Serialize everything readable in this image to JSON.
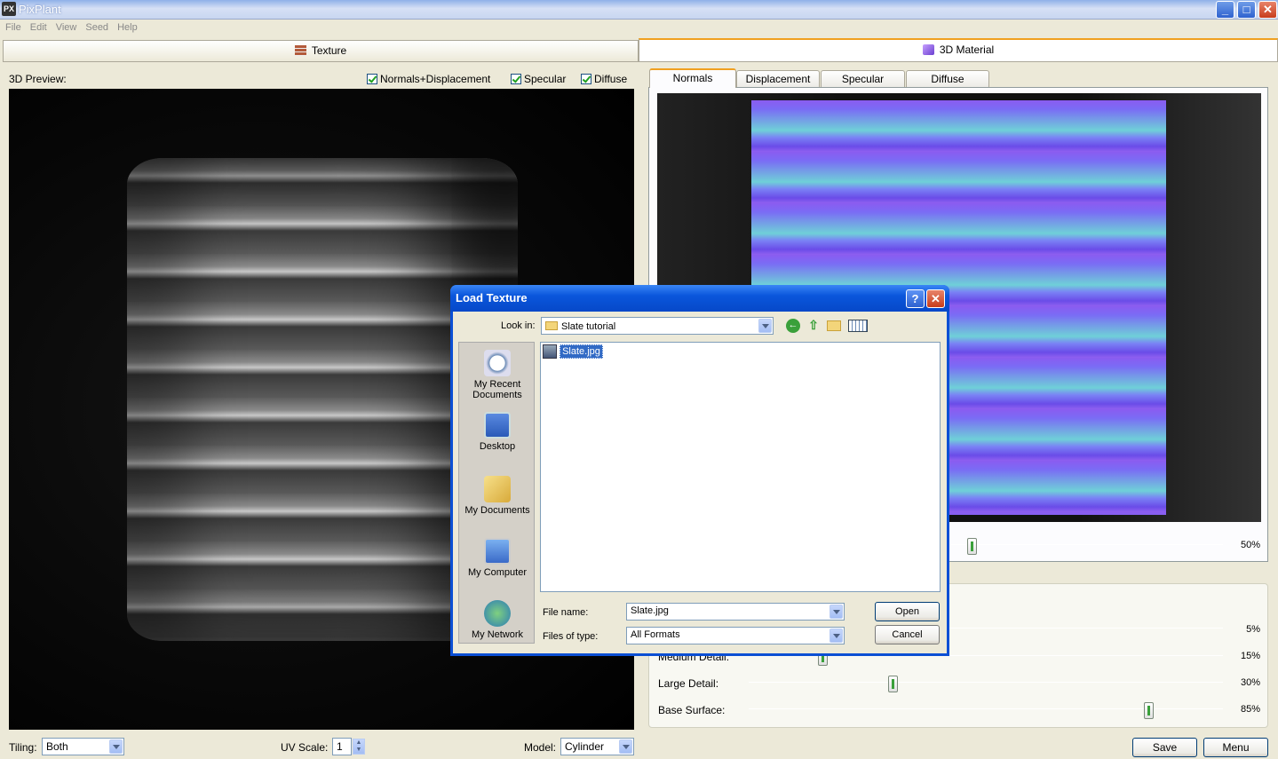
{
  "app": {
    "title": "PixPlant",
    "icon_text": "PX"
  },
  "window_controls": {
    "minimize": "_",
    "maximize": "□",
    "close": "✕"
  },
  "menu": [
    "File",
    "Edit",
    "View",
    "Seed",
    "Help"
  ],
  "panels": {
    "texture": "Texture",
    "material": "3D Material"
  },
  "left": {
    "preview_label": "3D Preview:",
    "checks": [
      {
        "label": "Normals+Displacement",
        "checked": true
      },
      {
        "label": "Specular",
        "checked": true
      },
      {
        "label": "Diffuse",
        "checked": true
      }
    ],
    "tiling_label": "Tiling:",
    "tiling_value": "Both",
    "uv_label": "UV Scale:",
    "uv_value": "1",
    "model_label": "Model:",
    "model_value": "Cylinder"
  },
  "right": {
    "tabs": [
      "Normals",
      "Displacement",
      "Specular",
      "Diffuse"
    ],
    "active_tab": "Normals",
    "strength_value": "50%",
    "detail_rows": [
      {
        "label": "",
        "value": "5%"
      },
      {
        "label": "Medium Detail:",
        "value": "15%"
      },
      {
        "label": "Large Detail:",
        "value": "30%"
      },
      {
        "label": "Base Surface:",
        "value": "85%"
      }
    ],
    "save_label": "Save",
    "menu_label": "Menu"
  },
  "dialog": {
    "title": "Load Texture",
    "help": "?",
    "close": "✕",
    "look_in_label": "Look in:",
    "look_in_value": "Slate tutorial",
    "places": [
      "My Recent Documents",
      "Desktop",
      "My Documents",
      "My Computer",
      "My Network"
    ],
    "files": [
      "Slate.jpg"
    ],
    "file_name_label": "File name:",
    "file_name_value": "Slate.jpg",
    "file_type_label": "Files of type:",
    "file_type_value": "All Formats",
    "open_label": "Open",
    "cancel_label": "Cancel"
  },
  "colors": {
    "accent_tab": "#f0a020",
    "title_blue": "#0a56dc",
    "normal_map": "#7a6cf5"
  }
}
